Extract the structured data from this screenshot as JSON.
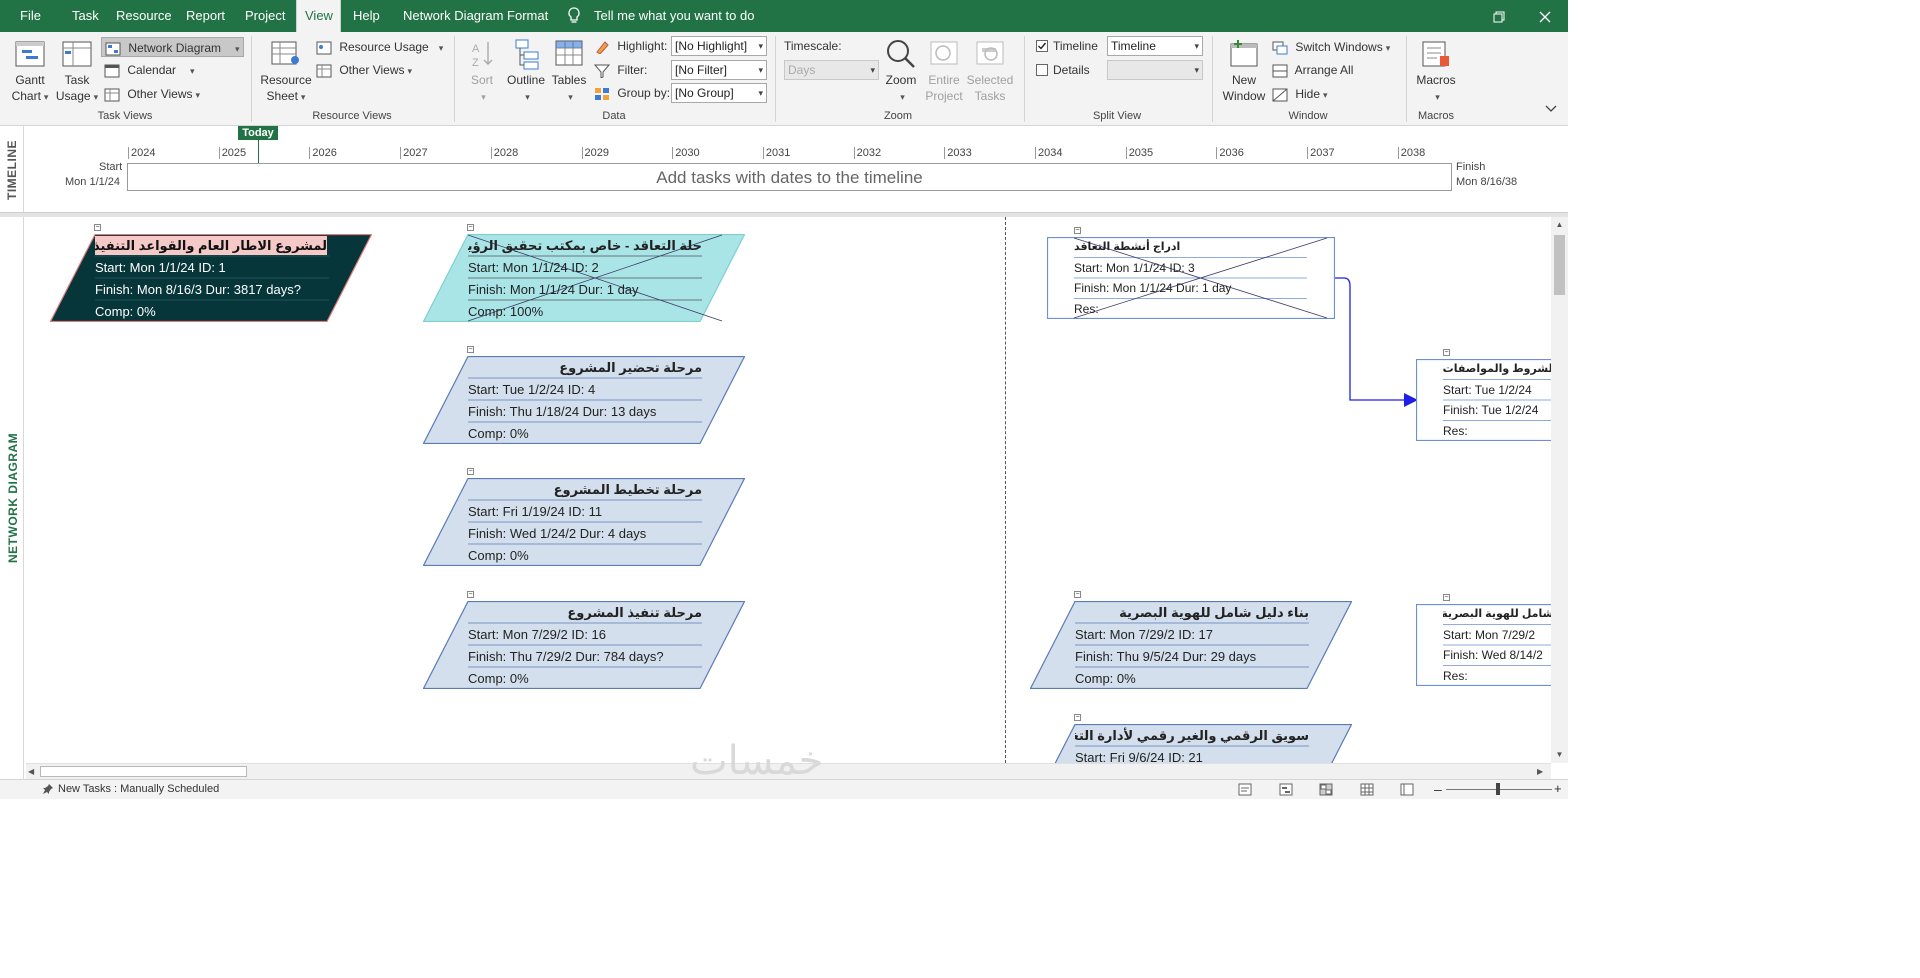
{
  "tabs": [
    "File",
    "Task",
    "Resource",
    "Report",
    "Project",
    "View",
    "Help",
    "Network Diagram Format"
  ],
  "active_tab": "View",
  "tell_me": "Tell me what you want to do",
  "ribbon": {
    "task_views": {
      "label": "Task Views",
      "gantt": "Gantt",
      "gantt2": "Chart",
      "task_usage": "Task",
      "task_usage2": "Usage",
      "network_diagram": "Network Diagram",
      "calendar": "Calendar",
      "other_views": "Other Views"
    },
    "resource_views": {
      "label": "Resource Views",
      "resource_sheet": "Resource",
      "resource_sheet2": "Sheet",
      "resource_usage": "Resource Usage",
      "other_views": "Other Views"
    },
    "data": {
      "label": "Data",
      "sort": "Sort",
      "outline": "Outline",
      "tables": "Tables",
      "highlight_label": "Highlight:",
      "highlight_value": "[No Highlight]",
      "filter_label": "Filter:",
      "filter_value": "[No Filter]",
      "group_label": "Group by:",
      "group_value": "[No Group]"
    },
    "zoom": {
      "label": "Zoom",
      "timescale_label": "Timescale:",
      "timescale_value": "Days",
      "zoom": "Zoom",
      "entire_project": "Entire",
      "entire_project2": "Project",
      "selected_tasks": "Selected",
      "selected_tasks2": "Tasks"
    },
    "split_view": {
      "label": "Split View",
      "timeline_label": "Timeline",
      "timeline_checked": true,
      "timeline_value": "Timeline",
      "details_label": "Details",
      "details_checked": false
    },
    "window": {
      "label": "Window",
      "new_window": "New",
      "new_window2": "Window",
      "switch_windows": "Switch Windows",
      "arrange_all": "Arrange All",
      "hide": "Hide"
    },
    "macros": {
      "label": "Macros",
      "macros": "Macros"
    }
  },
  "timeline": {
    "side_label": "TIMELINE",
    "today": "Today",
    "start_label": "Start",
    "start_date": "Mon 1/1/24",
    "finish_label": "Finish",
    "finish_date": "Mon 8/16/38",
    "hint": "Add tasks with dates to the timeline",
    "years": [
      "2024",
      "2025",
      "2026",
      "2027",
      "2028",
      "2029",
      "2030",
      "2031",
      "2032",
      "2033",
      "2034",
      "2035",
      "2036",
      "2037",
      "2038"
    ]
  },
  "network": {
    "side_label": "NETWORK DIAGRAM",
    "nodes": [
      {
        "title": "لمشروع الاطار العام والقواعد التنفيذية\"",
        "l1": "Start:  Mon 1/1/24  ID:   1",
        "l2": "Finish: Mon 8/16/3 Dur: 3817 days?",
        "l3": "Comp: 0%"
      },
      {
        "title": "حلة التعاقد - خاص بمكتب تحقيق الرؤية",
        "l1": "Start:  Mon 1/1/24  ID:   2",
        "l2": "Finish: Mon 1/1/24 Dur: 1 day",
        "l3": "Comp: 100%"
      },
      {
        "title": "مرحلة تحضير المشروع",
        "l1": "Start:  Tue 1/2/24   ID:   4",
        "l2": "Finish: Thu 1/18/24 Dur: 13 days",
        "l3": "Comp: 0%"
      },
      {
        "title": "مرحلة تخطيط المشروع",
        "l1": "Start:  Fri 1/19/24   ID:   11",
        "l2": "Finish: Wed 1/24/2 Dur: 4 days",
        "l3": "Comp: 0%"
      },
      {
        "title": "مرحلة تنفيذ المشروع",
        "l1": "Start:  Mon 7/29/2 ID:   16",
        "l2": "Finish: Thu 7/29/2 Dur: 784 days?",
        "l3": "Comp: 0%"
      },
      {
        "title": "ادراج أنشطة التعاقد",
        "l1": "Start:  Mon 1/1/24  ID:   3",
        "l2": "Finish: Mon 1/1/24 Dur: 1 day",
        "l3": "Res:"
      },
      {
        "title": "بناء دليل شامل للهوية البصرية",
        "l1": "Start:  Mon 7/29/2 ID:   17",
        "l2": "Finish: Thu 9/5/24  Dur: 29 days",
        "l3": "Comp: 0%"
      },
      {
        "title": "سويق الرقمي والغير رقمي لأدارة التغيير",
        "l1": "Start:  Fri 9/6/24    ID:   21",
        "l2": "",
        "l3": ""
      },
      {
        "title": "ة الشروط والمواصفات",
        "l1": "Start:  Tue 1/2/24",
        "l2": "Finish: Tue 1/2/24",
        "l3": "Res:"
      },
      {
        "title": "ل شامل للهوية البصرية",
        "l1": "Start:  Mon 7/29/2",
        "l2": "Finish: Wed 8/14/2",
        "l3": "Res:"
      }
    ]
  },
  "status": {
    "new_tasks": "New Tasks : Manually Scheduled"
  },
  "watermark": "خمسات",
  "colors": {
    "accent": "#217346",
    "summary_dark": "#06363a",
    "summary_title_bg": "#f6c9c9",
    "done_fill": "#a9e4e6",
    "summary_fill": "#d3dfec",
    "summary_stroke": "#5a7ab8",
    "task_stroke": "#6d8fd8",
    "link": "#1f1fe6"
  }
}
